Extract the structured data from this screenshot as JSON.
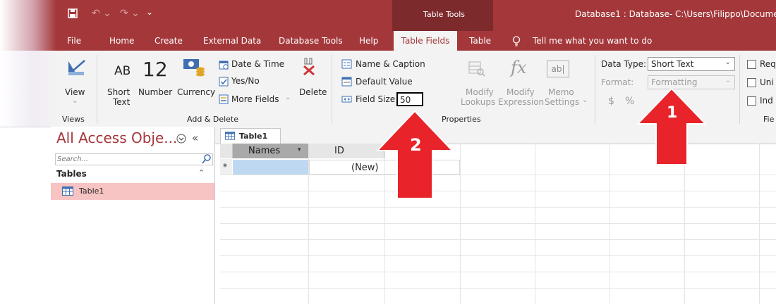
{
  "titlebar": {
    "contextual_title": "Table Tools",
    "window_title": "Database1 : Database- C:\\Users\\Filippo\\Document"
  },
  "tabs": [
    {
      "label": "File",
      "active": false
    },
    {
      "label": "Home",
      "active": false
    },
    {
      "label": "Create",
      "active": false
    },
    {
      "label": "External Data",
      "active": false
    },
    {
      "label": "Database Tools",
      "active": false
    },
    {
      "label": "Help",
      "active": false
    },
    {
      "label": "Table Fields",
      "active": true
    },
    {
      "label": "Table",
      "active": false
    }
  ],
  "tellme": "Tell me what you want to do",
  "ribbon": {
    "view": {
      "label": "View",
      "arrow": "⌄",
      "group": "Views"
    },
    "add_delete": {
      "short_text_glyph": "AB",
      "short_text_l1": "Short",
      "short_text_l2": "Text",
      "number_glyph": "12",
      "number_label": "Number",
      "currency_label": "Currency",
      "date_time": "Date & Time",
      "yes_no": "Yes/No",
      "more_fields": "More Fields",
      "delete": "Delete",
      "group": "Add & Delete"
    },
    "properties": {
      "name_caption": "Name & Caption",
      "default_value": "Default Value",
      "field_size_label": "Field Size",
      "field_size_value": "50",
      "modify_lookups_l1": "Modify",
      "modify_lookups_l2": "Lookups",
      "modify_expression_l1": "Modify",
      "modify_expression_l2": "Expression",
      "memo_settings_l1": "Memo",
      "memo_settings_l2": "Settings",
      "group": "Properties"
    },
    "formatting": {
      "data_type_label": "Data Type:",
      "data_type_value": "Short Text",
      "format_label": "Format:",
      "format_value": "Formatting",
      "dollar": "$",
      "percent": "%"
    },
    "validation": {
      "required": "Req",
      "unique": "Uni",
      "indexed": "Ind",
      "group": "Fie"
    }
  },
  "nav": {
    "title": "All Access Obje...",
    "search_placeholder": "Search...",
    "section": "Tables",
    "items": [
      "Table1"
    ]
  },
  "document_tab": "Table1",
  "datasheet": {
    "columns": [
      "Names",
      "ID"
    ],
    "new_row_marker": "*",
    "new_row_id": "(New)"
  },
  "annotations": [
    {
      "label": "1",
      "color": "#e8232a"
    },
    {
      "label": "2",
      "color": "#e8232a"
    }
  ],
  "colors": {
    "access_red": "#a4373a",
    "arrow_red": "#e8232a",
    "selected_item": "#f8c3c3",
    "selected_cell": "#bfd8f2"
  }
}
